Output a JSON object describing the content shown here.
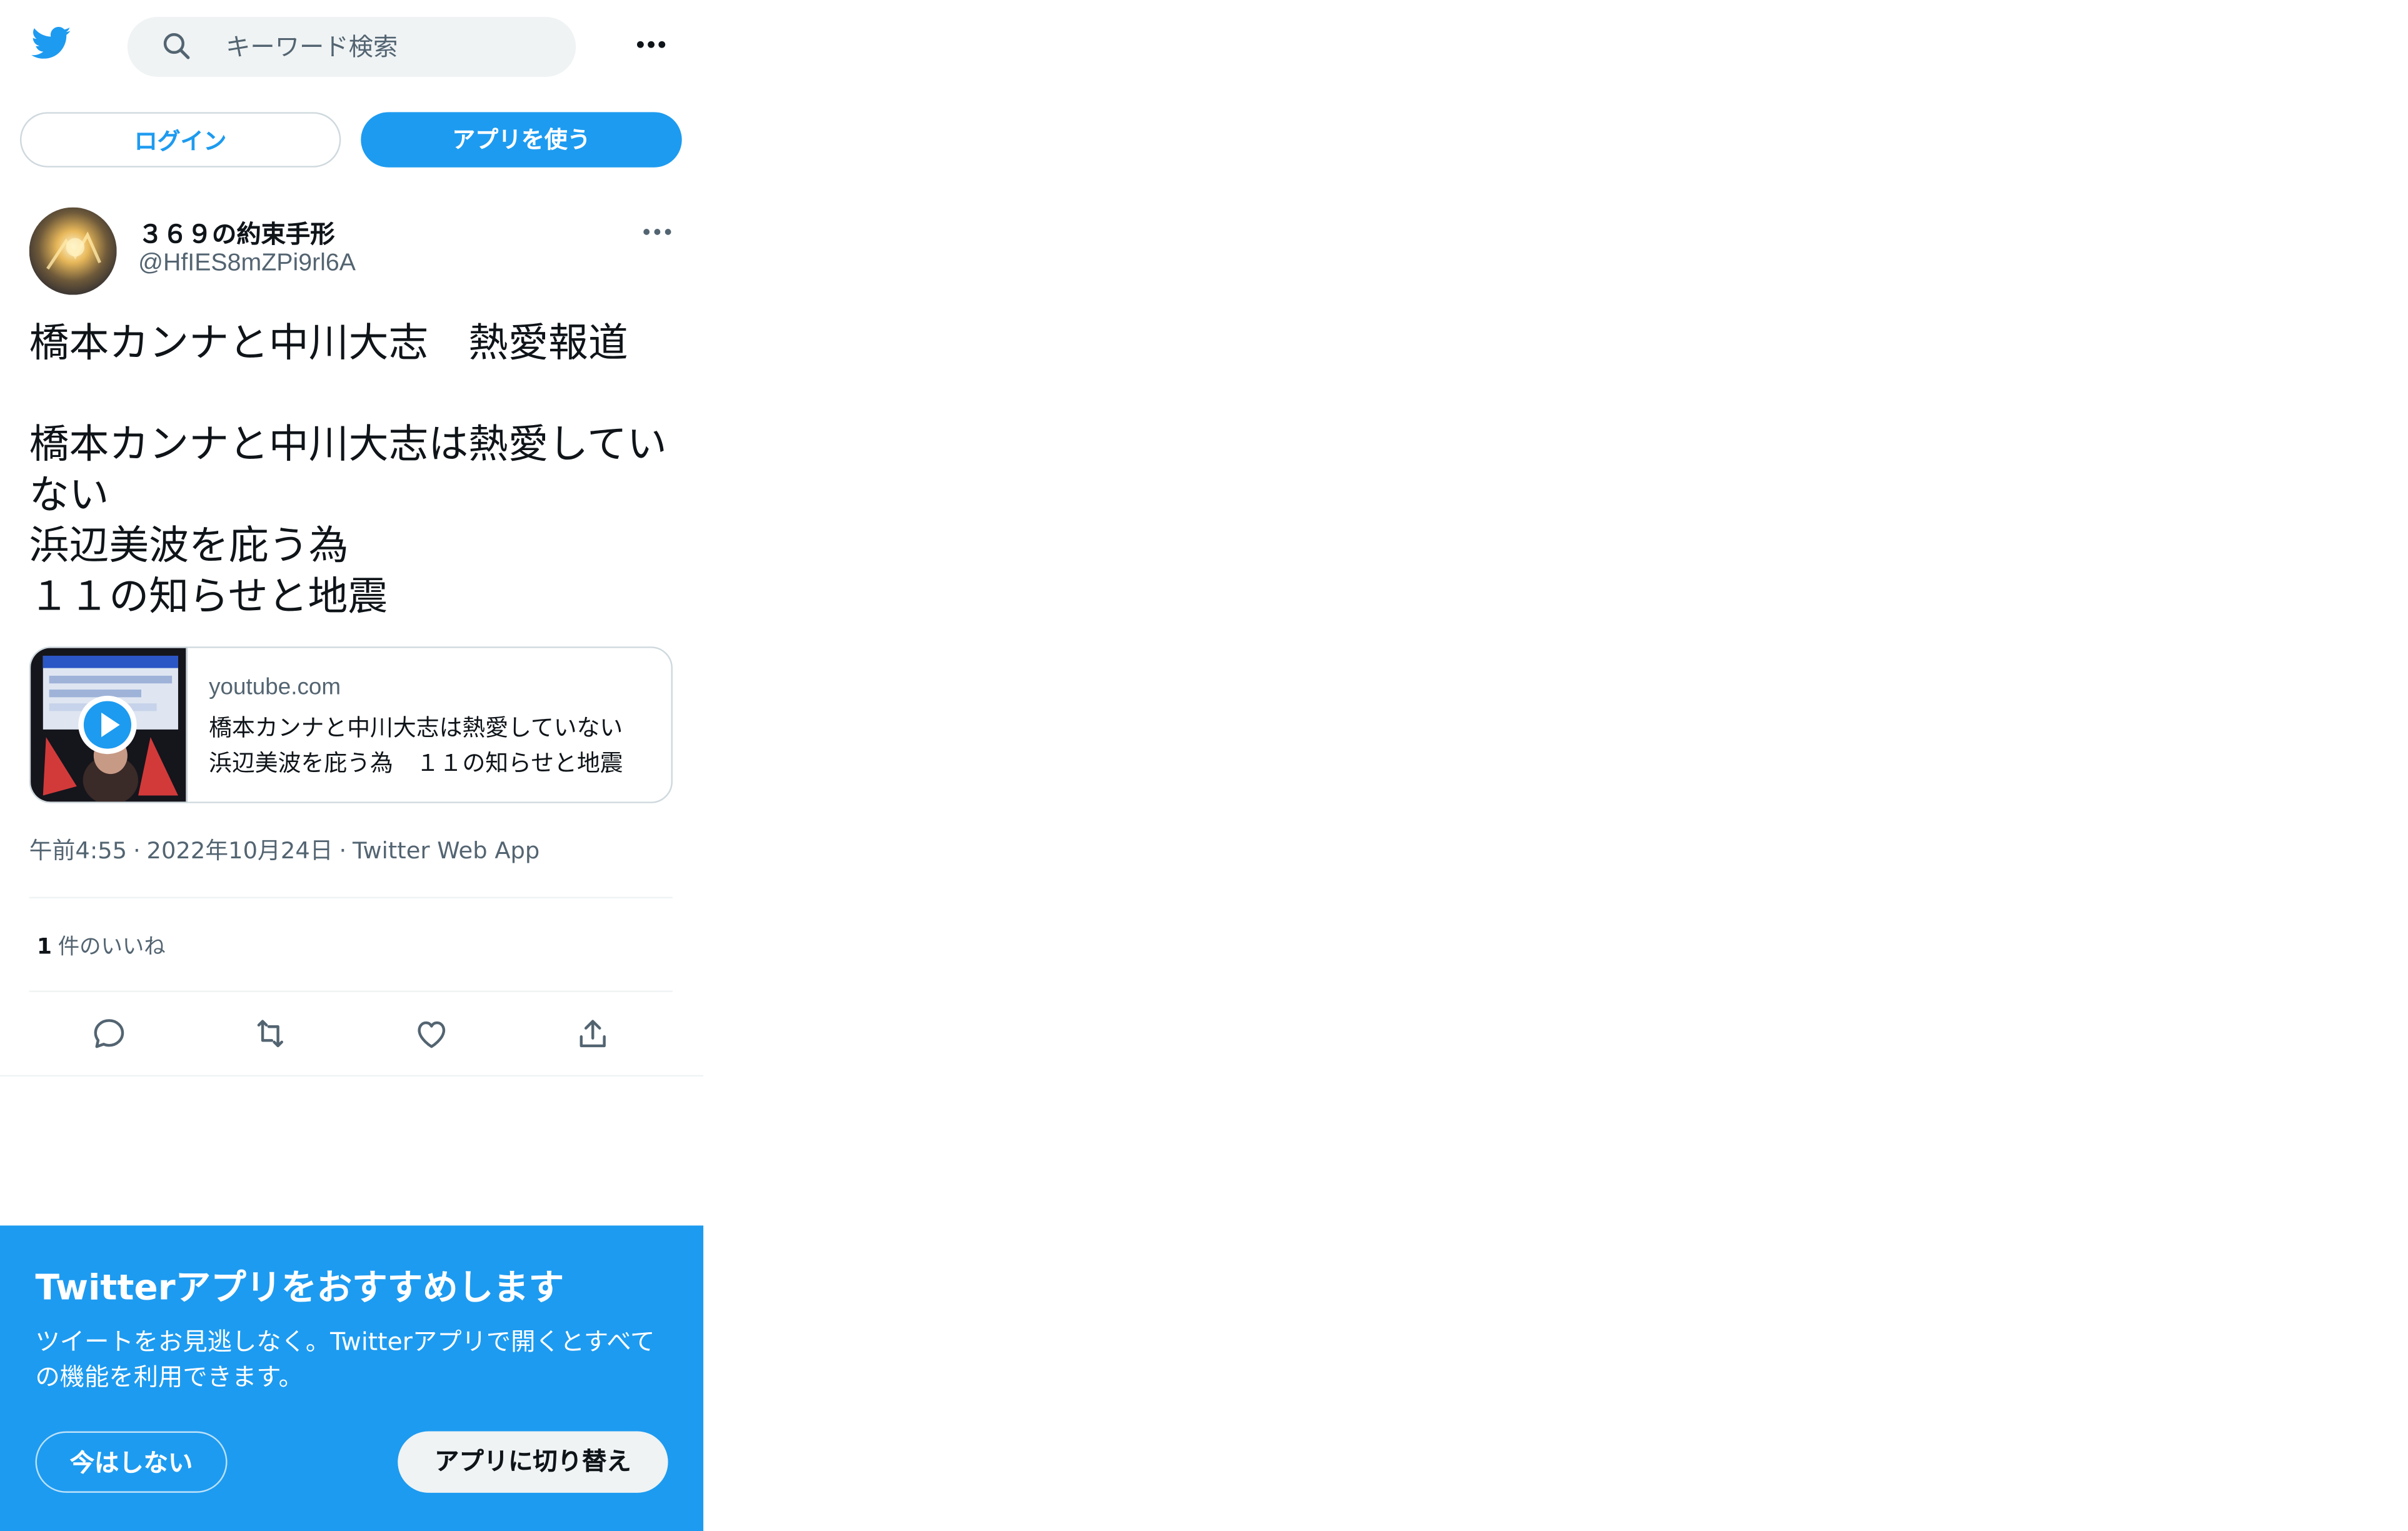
{
  "colors": {
    "accent": "#1d9bf0",
    "text": "#0f1419",
    "muted": "#536471",
    "border": "#cfd9de"
  },
  "header": {
    "logo_icon": "twitter-bird-icon",
    "search_placeholder": "キーワード検索",
    "more_icon": "more-horizontal-icon"
  },
  "auth": {
    "login_label": "ログイン",
    "app_label": "アプリを使う"
  },
  "tweet": {
    "author_name": "３６９の約束手形",
    "author_handle": "@HfIES8mZPi9rl6A",
    "text": "橋本カンナと中川大志　熱愛報道\n\n橋本カンナと中川大志は熱愛していない\n浜辺美波を庇う為\n１１の知らせと地震",
    "card": {
      "domain": "youtube.com",
      "title": "橋本カンナと中川大志は熱愛していない　浜辺美波を庇う為　１１の知らせと地震"
    },
    "time": "午前4:55",
    "date": "2022年10月24日",
    "source": "Twitter Web App",
    "separator": "·",
    "like_count": "1",
    "like_label": "件のいいね"
  },
  "actions": [
    "reply-icon",
    "retweet-icon",
    "like-icon",
    "share-icon"
  ],
  "banner": {
    "title": "Twitterアプリをおすすめします",
    "description": "ツイートをお見逃しなく。Twitterアプリで開くとすべての機能を利用できます。",
    "later_label": "今はしない",
    "switch_label": "アプリに切り替え"
  }
}
